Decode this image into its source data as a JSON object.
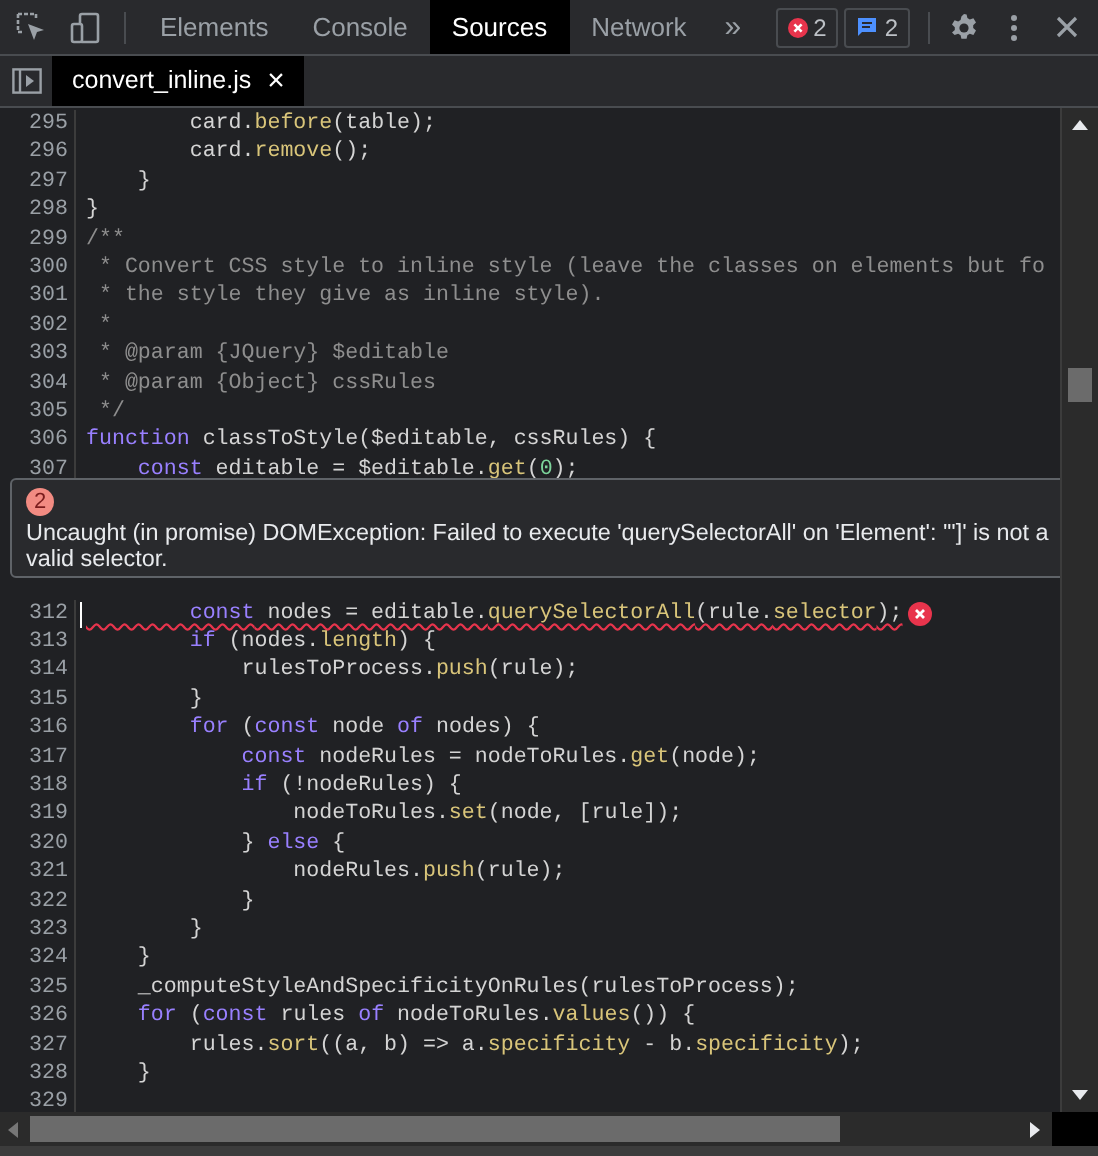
{
  "toolbar": {
    "tabs": [
      {
        "label": "Elements",
        "selected": false
      },
      {
        "label": "Console",
        "selected": false
      },
      {
        "label": "Sources",
        "selected": true
      },
      {
        "label": "Network",
        "selected": false
      }
    ],
    "more": "»",
    "error_count": "2",
    "message_count": "2"
  },
  "file_tabs": [
    {
      "label": "convert_inline.js",
      "selected": true,
      "close": "×"
    }
  ],
  "code": {
    "lines_above": [
      {
        "number": "295",
        "error": false,
        "cursor": false,
        "tokens": [
          {
            "kind": "plain",
            "text": "        card."
          },
          {
            "kind": "method",
            "text": "before"
          },
          {
            "kind": "plain",
            "text": "(table);"
          }
        ]
      },
      {
        "number": "296",
        "error": false,
        "cursor": false,
        "tokens": [
          {
            "kind": "plain",
            "text": "        card."
          },
          {
            "kind": "method",
            "text": "remove"
          },
          {
            "kind": "plain",
            "text": "();"
          }
        ]
      },
      {
        "number": "297",
        "error": false,
        "cursor": false,
        "tokens": [
          {
            "kind": "plain",
            "text": "    }"
          }
        ]
      },
      {
        "number": "298",
        "error": false,
        "cursor": false,
        "tokens": [
          {
            "kind": "plain",
            "text": "}"
          }
        ]
      },
      {
        "number": "299",
        "error": false,
        "cursor": false,
        "tokens": [
          {
            "kind": "comment",
            "text": "/**"
          }
        ]
      },
      {
        "number": "300",
        "error": false,
        "cursor": false,
        "tokens": [
          {
            "kind": "comment",
            "text": " * Convert CSS style to inline style (leave the classes on elements but fo"
          }
        ]
      },
      {
        "number": "301",
        "error": false,
        "cursor": false,
        "tokens": [
          {
            "kind": "comment",
            "text": " * the style they give as inline style)."
          }
        ]
      },
      {
        "number": "302",
        "error": false,
        "cursor": false,
        "tokens": [
          {
            "kind": "comment",
            "text": " *"
          }
        ]
      },
      {
        "number": "303",
        "error": false,
        "cursor": false,
        "tokens": [
          {
            "kind": "comment",
            "text": " * @param {JQuery} $editable"
          }
        ]
      },
      {
        "number": "304",
        "error": false,
        "cursor": false,
        "tokens": [
          {
            "kind": "comment",
            "text": " * @param {Object} cssRules"
          }
        ]
      },
      {
        "number": "305",
        "error": false,
        "cursor": false,
        "tokens": [
          {
            "kind": "comment",
            "text": " */"
          }
        ]
      },
      {
        "number": "306",
        "error": false,
        "cursor": false,
        "tokens": [
          {
            "kind": "keyword",
            "text": "function"
          },
          {
            "kind": "plain",
            "text": " classToStyle($editable, cssRules) {"
          }
        ]
      },
      {
        "number": "307",
        "error": false,
        "cursor": false,
        "tokens": [
          {
            "kind": "keyword",
            "text": "    const"
          },
          {
            "kind": "plain",
            "text": " editable = $editable."
          },
          {
            "kind": "method",
            "text": "get"
          },
          {
            "kind": "plain",
            "text": "("
          },
          {
            "kind": "number",
            "text": "0"
          },
          {
            "kind": "plain",
            "text": ");"
          }
        ]
      }
    ],
    "tooltip": {
      "badge": "2",
      "message": "Uncaught (in promise) DOMException: Failed to execute 'querySelectorAll' on 'Element': '\"]' is not a valid selector."
    },
    "lines_below": [
      {
        "number": "312",
        "error": true,
        "cursor": true,
        "tokens": [
          {
            "kind": "keyword",
            "text": "        const"
          },
          {
            "kind": "plain",
            "text": " nodes = editable."
          },
          {
            "kind": "method",
            "text": "querySelectorAll"
          },
          {
            "kind": "plain",
            "text": "(rule."
          },
          {
            "kind": "method",
            "text": "selector"
          },
          {
            "kind": "plain",
            "text": ");"
          }
        ]
      },
      {
        "number": "313",
        "error": false,
        "cursor": false,
        "tokens": [
          {
            "kind": "keyword",
            "text": "        if"
          },
          {
            "kind": "plain",
            "text": " (nodes."
          },
          {
            "kind": "method",
            "text": "length"
          },
          {
            "kind": "plain",
            "text": ") {"
          }
        ]
      },
      {
        "number": "314",
        "error": false,
        "cursor": false,
        "tokens": [
          {
            "kind": "plain",
            "text": "            rulesToProcess."
          },
          {
            "kind": "method",
            "text": "push"
          },
          {
            "kind": "plain",
            "text": "(rule);"
          }
        ]
      },
      {
        "number": "315",
        "error": false,
        "cursor": false,
        "tokens": [
          {
            "kind": "plain",
            "text": "        }"
          }
        ]
      },
      {
        "number": "316",
        "error": false,
        "cursor": false,
        "tokens": [
          {
            "kind": "keyword",
            "text": "        for"
          },
          {
            "kind": "plain",
            "text": " ("
          },
          {
            "kind": "keyword",
            "text": "const"
          },
          {
            "kind": "plain",
            "text": " node "
          },
          {
            "kind": "keyword",
            "text": "of"
          },
          {
            "kind": "plain",
            "text": " nodes) {"
          }
        ]
      },
      {
        "number": "317",
        "error": false,
        "cursor": false,
        "tokens": [
          {
            "kind": "keyword",
            "text": "            const"
          },
          {
            "kind": "plain",
            "text": " nodeRules = nodeToRules."
          },
          {
            "kind": "method",
            "text": "get"
          },
          {
            "kind": "plain",
            "text": "(node);"
          }
        ]
      },
      {
        "number": "318",
        "error": false,
        "cursor": false,
        "tokens": [
          {
            "kind": "keyword",
            "text": "            if"
          },
          {
            "kind": "plain",
            "text": " (!nodeRules) {"
          }
        ]
      },
      {
        "number": "319",
        "error": false,
        "cursor": false,
        "tokens": [
          {
            "kind": "plain",
            "text": "                nodeToRules."
          },
          {
            "kind": "method",
            "text": "set"
          },
          {
            "kind": "plain",
            "text": "(node, [rule]);"
          }
        ]
      },
      {
        "number": "320",
        "error": false,
        "cursor": false,
        "tokens": [
          {
            "kind": "plain",
            "text": "            } "
          },
          {
            "kind": "keyword",
            "text": "else"
          },
          {
            "kind": "plain",
            "text": " {"
          }
        ]
      },
      {
        "number": "321",
        "error": false,
        "cursor": false,
        "tokens": [
          {
            "kind": "plain",
            "text": "                nodeRules."
          },
          {
            "kind": "method",
            "text": "push"
          },
          {
            "kind": "plain",
            "text": "(rule);"
          }
        ]
      },
      {
        "number": "322",
        "error": false,
        "cursor": false,
        "tokens": [
          {
            "kind": "plain",
            "text": "            }"
          }
        ]
      },
      {
        "number": "323",
        "error": false,
        "cursor": false,
        "tokens": [
          {
            "kind": "plain",
            "text": "        }"
          }
        ]
      },
      {
        "number": "324",
        "error": false,
        "cursor": false,
        "tokens": [
          {
            "kind": "plain",
            "text": "    }"
          }
        ]
      },
      {
        "number": "325",
        "error": false,
        "cursor": false,
        "tokens": [
          {
            "kind": "plain",
            "text": "    _computeStyleAndSpecificityOnRules(rulesToProcess);"
          }
        ]
      },
      {
        "number": "326",
        "error": false,
        "cursor": false,
        "tokens": [
          {
            "kind": "keyword",
            "text": "    for"
          },
          {
            "kind": "plain",
            "text": " ("
          },
          {
            "kind": "keyword",
            "text": "const"
          },
          {
            "kind": "plain",
            "text": " rules "
          },
          {
            "kind": "keyword",
            "text": "of"
          },
          {
            "kind": "plain",
            "text": " nodeToRules."
          },
          {
            "kind": "method",
            "text": "values"
          },
          {
            "kind": "plain",
            "text": "()) {"
          }
        ]
      },
      {
        "number": "327",
        "error": false,
        "cursor": false,
        "tokens": [
          {
            "kind": "plain",
            "text": "        rules."
          },
          {
            "kind": "method",
            "text": "sort"
          },
          {
            "kind": "plain",
            "text": "((a, b) => a."
          },
          {
            "kind": "method",
            "text": "specificity"
          },
          {
            "kind": "plain",
            "text": " - b."
          },
          {
            "kind": "method",
            "text": "specificity"
          },
          {
            "kind": "plain",
            "text": ");"
          }
        ]
      },
      {
        "number": "328",
        "error": false,
        "cursor": false,
        "tokens": [
          {
            "kind": "plain",
            "text": "    }"
          }
        ]
      },
      {
        "number": "329"
      }
    ]
  }
}
